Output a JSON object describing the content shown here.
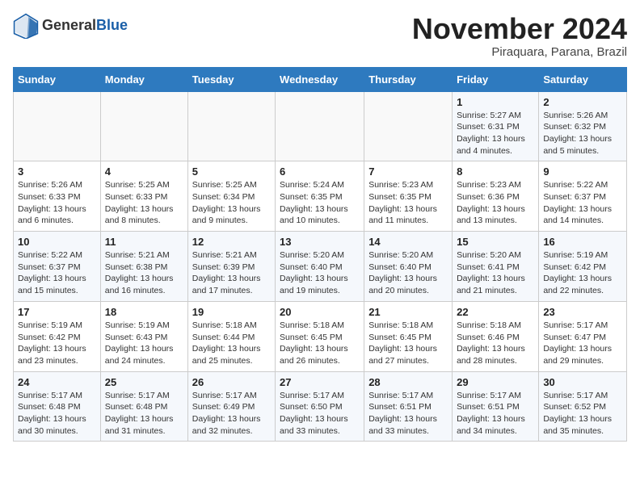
{
  "header": {
    "logo_line1": "General",
    "logo_line2": "Blue",
    "month": "November 2024",
    "location": "Piraquara, Parana, Brazil"
  },
  "days_of_week": [
    "Sunday",
    "Monday",
    "Tuesday",
    "Wednesday",
    "Thursday",
    "Friday",
    "Saturday"
  ],
  "weeks": [
    [
      {
        "day": "",
        "info": ""
      },
      {
        "day": "",
        "info": ""
      },
      {
        "day": "",
        "info": ""
      },
      {
        "day": "",
        "info": ""
      },
      {
        "day": "",
        "info": ""
      },
      {
        "day": "1",
        "info": "Sunrise: 5:27 AM\nSunset: 6:31 PM\nDaylight: 13 hours and 4 minutes."
      },
      {
        "day": "2",
        "info": "Sunrise: 5:26 AM\nSunset: 6:32 PM\nDaylight: 13 hours and 5 minutes."
      }
    ],
    [
      {
        "day": "3",
        "info": "Sunrise: 5:26 AM\nSunset: 6:33 PM\nDaylight: 13 hours and 6 minutes."
      },
      {
        "day": "4",
        "info": "Sunrise: 5:25 AM\nSunset: 6:33 PM\nDaylight: 13 hours and 8 minutes."
      },
      {
        "day": "5",
        "info": "Sunrise: 5:25 AM\nSunset: 6:34 PM\nDaylight: 13 hours and 9 minutes."
      },
      {
        "day": "6",
        "info": "Sunrise: 5:24 AM\nSunset: 6:35 PM\nDaylight: 13 hours and 10 minutes."
      },
      {
        "day": "7",
        "info": "Sunrise: 5:23 AM\nSunset: 6:35 PM\nDaylight: 13 hours and 11 minutes."
      },
      {
        "day": "8",
        "info": "Sunrise: 5:23 AM\nSunset: 6:36 PM\nDaylight: 13 hours and 13 minutes."
      },
      {
        "day": "9",
        "info": "Sunrise: 5:22 AM\nSunset: 6:37 PM\nDaylight: 13 hours and 14 minutes."
      }
    ],
    [
      {
        "day": "10",
        "info": "Sunrise: 5:22 AM\nSunset: 6:37 PM\nDaylight: 13 hours and 15 minutes."
      },
      {
        "day": "11",
        "info": "Sunrise: 5:21 AM\nSunset: 6:38 PM\nDaylight: 13 hours and 16 minutes."
      },
      {
        "day": "12",
        "info": "Sunrise: 5:21 AM\nSunset: 6:39 PM\nDaylight: 13 hours and 17 minutes."
      },
      {
        "day": "13",
        "info": "Sunrise: 5:20 AM\nSunset: 6:40 PM\nDaylight: 13 hours and 19 minutes."
      },
      {
        "day": "14",
        "info": "Sunrise: 5:20 AM\nSunset: 6:40 PM\nDaylight: 13 hours and 20 minutes."
      },
      {
        "day": "15",
        "info": "Sunrise: 5:20 AM\nSunset: 6:41 PM\nDaylight: 13 hours and 21 minutes."
      },
      {
        "day": "16",
        "info": "Sunrise: 5:19 AM\nSunset: 6:42 PM\nDaylight: 13 hours and 22 minutes."
      }
    ],
    [
      {
        "day": "17",
        "info": "Sunrise: 5:19 AM\nSunset: 6:42 PM\nDaylight: 13 hours and 23 minutes."
      },
      {
        "day": "18",
        "info": "Sunrise: 5:19 AM\nSunset: 6:43 PM\nDaylight: 13 hours and 24 minutes."
      },
      {
        "day": "19",
        "info": "Sunrise: 5:18 AM\nSunset: 6:44 PM\nDaylight: 13 hours and 25 minutes."
      },
      {
        "day": "20",
        "info": "Sunrise: 5:18 AM\nSunset: 6:45 PM\nDaylight: 13 hours and 26 minutes."
      },
      {
        "day": "21",
        "info": "Sunrise: 5:18 AM\nSunset: 6:45 PM\nDaylight: 13 hours and 27 minutes."
      },
      {
        "day": "22",
        "info": "Sunrise: 5:18 AM\nSunset: 6:46 PM\nDaylight: 13 hours and 28 minutes."
      },
      {
        "day": "23",
        "info": "Sunrise: 5:17 AM\nSunset: 6:47 PM\nDaylight: 13 hours and 29 minutes."
      }
    ],
    [
      {
        "day": "24",
        "info": "Sunrise: 5:17 AM\nSunset: 6:48 PM\nDaylight: 13 hours and 30 minutes."
      },
      {
        "day": "25",
        "info": "Sunrise: 5:17 AM\nSunset: 6:48 PM\nDaylight: 13 hours and 31 minutes."
      },
      {
        "day": "26",
        "info": "Sunrise: 5:17 AM\nSunset: 6:49 PM\nDaylight: 13 hours and 32 minutes."
      },
      {
        "day": "27",
        "info": "Sunrise: 5:17 AM\nSunset: 6:50 PM\nDaylight: 13 hours and 33 minutes."
      },
      {
        "day": "28",
        "info": "Sunrise: 5:17 AM\nSunset: 6:51 PM\nDaylight: 13 hours and 33 minutes."
      },
      {
        "day": "29",
        "info": "Sunrise: 5:17 AM\nSunset: 6:51 PM\nDaylight: 13 hours and 34 minutes."
      },
      {
        "day": "30",
        "info": "Sunrise: 5:17 AM\nSunset: 6:52 PM\nDaylight: 13 hours and 35 minutes."
      }
    ]
  ]
}
